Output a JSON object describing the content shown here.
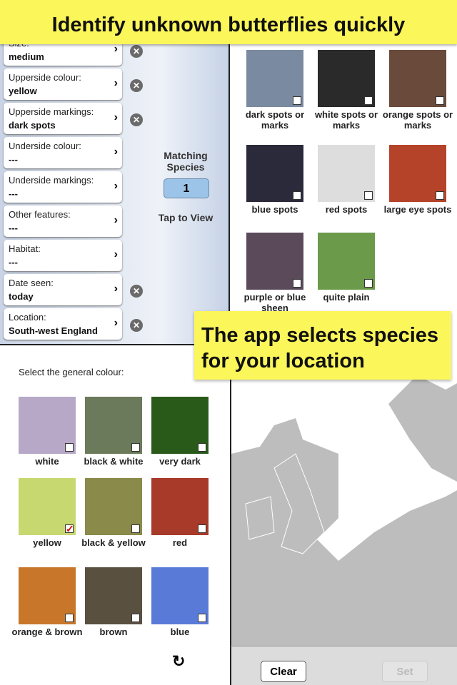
{
  "banners": {
    "top": "Identify unknown butterflies quickly",
    "location": "The app selects species for your location"
  },
  "filters": [
    {
      "label": "Size:",
      "value": "medium",
      "clearable": true
    },
    {
      "label": "Upperside colour:",
      "value": "yellow",
      "clearable": true
    },
    {
      "label": "Upperside markings:",
      "value": "dark spots",
      "clearable": true
    },
    {
      "label": "Underside colour:",
      "value": "---",
      "clearable": false
    },
    {
      "label": "Underside markings:",
      "value": "---",
      "clearable": false
    },
    {
      "label": "Other features:",
      "value": "---",
      "clearable": false
    },
    {
      "label": "Habitat:",
      "value": "---",
      "clearable": false
    },
    {
      "label": "Date seen:",
      "value": "today",
      "clearable": true
    },
    {
      "label": "Location:",
      "value": "South-west England",
      "clearable": true
    }
  ],
  "matching": {
    "label": "Matching Species",
    "count": "1",
    "tap": "Tap to View"
  },
  "markings": [
    {
      "label": "dark spots or marks",
      "color": "#7a8aa0",
      "checked": false
    },
    {
      "label": "white spots or marks",
      "color": "#2a2a2a",
      "checked": false
    },
    {
      "label": "orange spots or marks",
      "color": "#6a4a3a",
      "checked": false
    },
    {
      "label": "blue spots",
      "color": "#2a2a3a",
      "checked": false
    },
    {
      "label": "red spots",
      "color": "#ddd",
      "checked": false
    },
    {
      "label": "large eye spots",
      "color": "#b5432a",
      "checked": false
    },
    {
      "label": "purple or blue sheen",
      "color": "#5a4a5a",
      "checked": false
    },
    {
      "label": "quite plain",
      "color": "#6a9a4a",
      "checked": false
    }
  ],
  "colour_prompt": "Select the general colour:",
  "colours": [
    {
      "label": "white",
      "color": "#b8a8c8",
      "checked": false
    },
    {
      "label": "black & white",
      "color": "#6a7a5a",
      "checked": false
    },
    {
      "label": "very dark",
      "color": "#2a5a1a",
      "checked": false
    },
    {
      "label": "yellow",
      "color": "#c8d870",
      "checked": true
    },
    {
      "label": "black & yellow",
      "color": "#8a8a4a",
      "checked": false
    },
    {
      "label": "red",
      "color": "#a83a2a",
      "checked": false
    },
    {
      "label": "orange & brown",
      "color": "#c8762a",
      "checked": false
    },
    {
      "label": "brown",
      "color": "#5a5040",
      "checked": false
    },
    {
      "label": "blue",
      "color": "#5a7ad8",
      "checked": false
    }
  ],
  "toolbar": {
    "clear": "Clear",
    "set": "Set"
  }
}
